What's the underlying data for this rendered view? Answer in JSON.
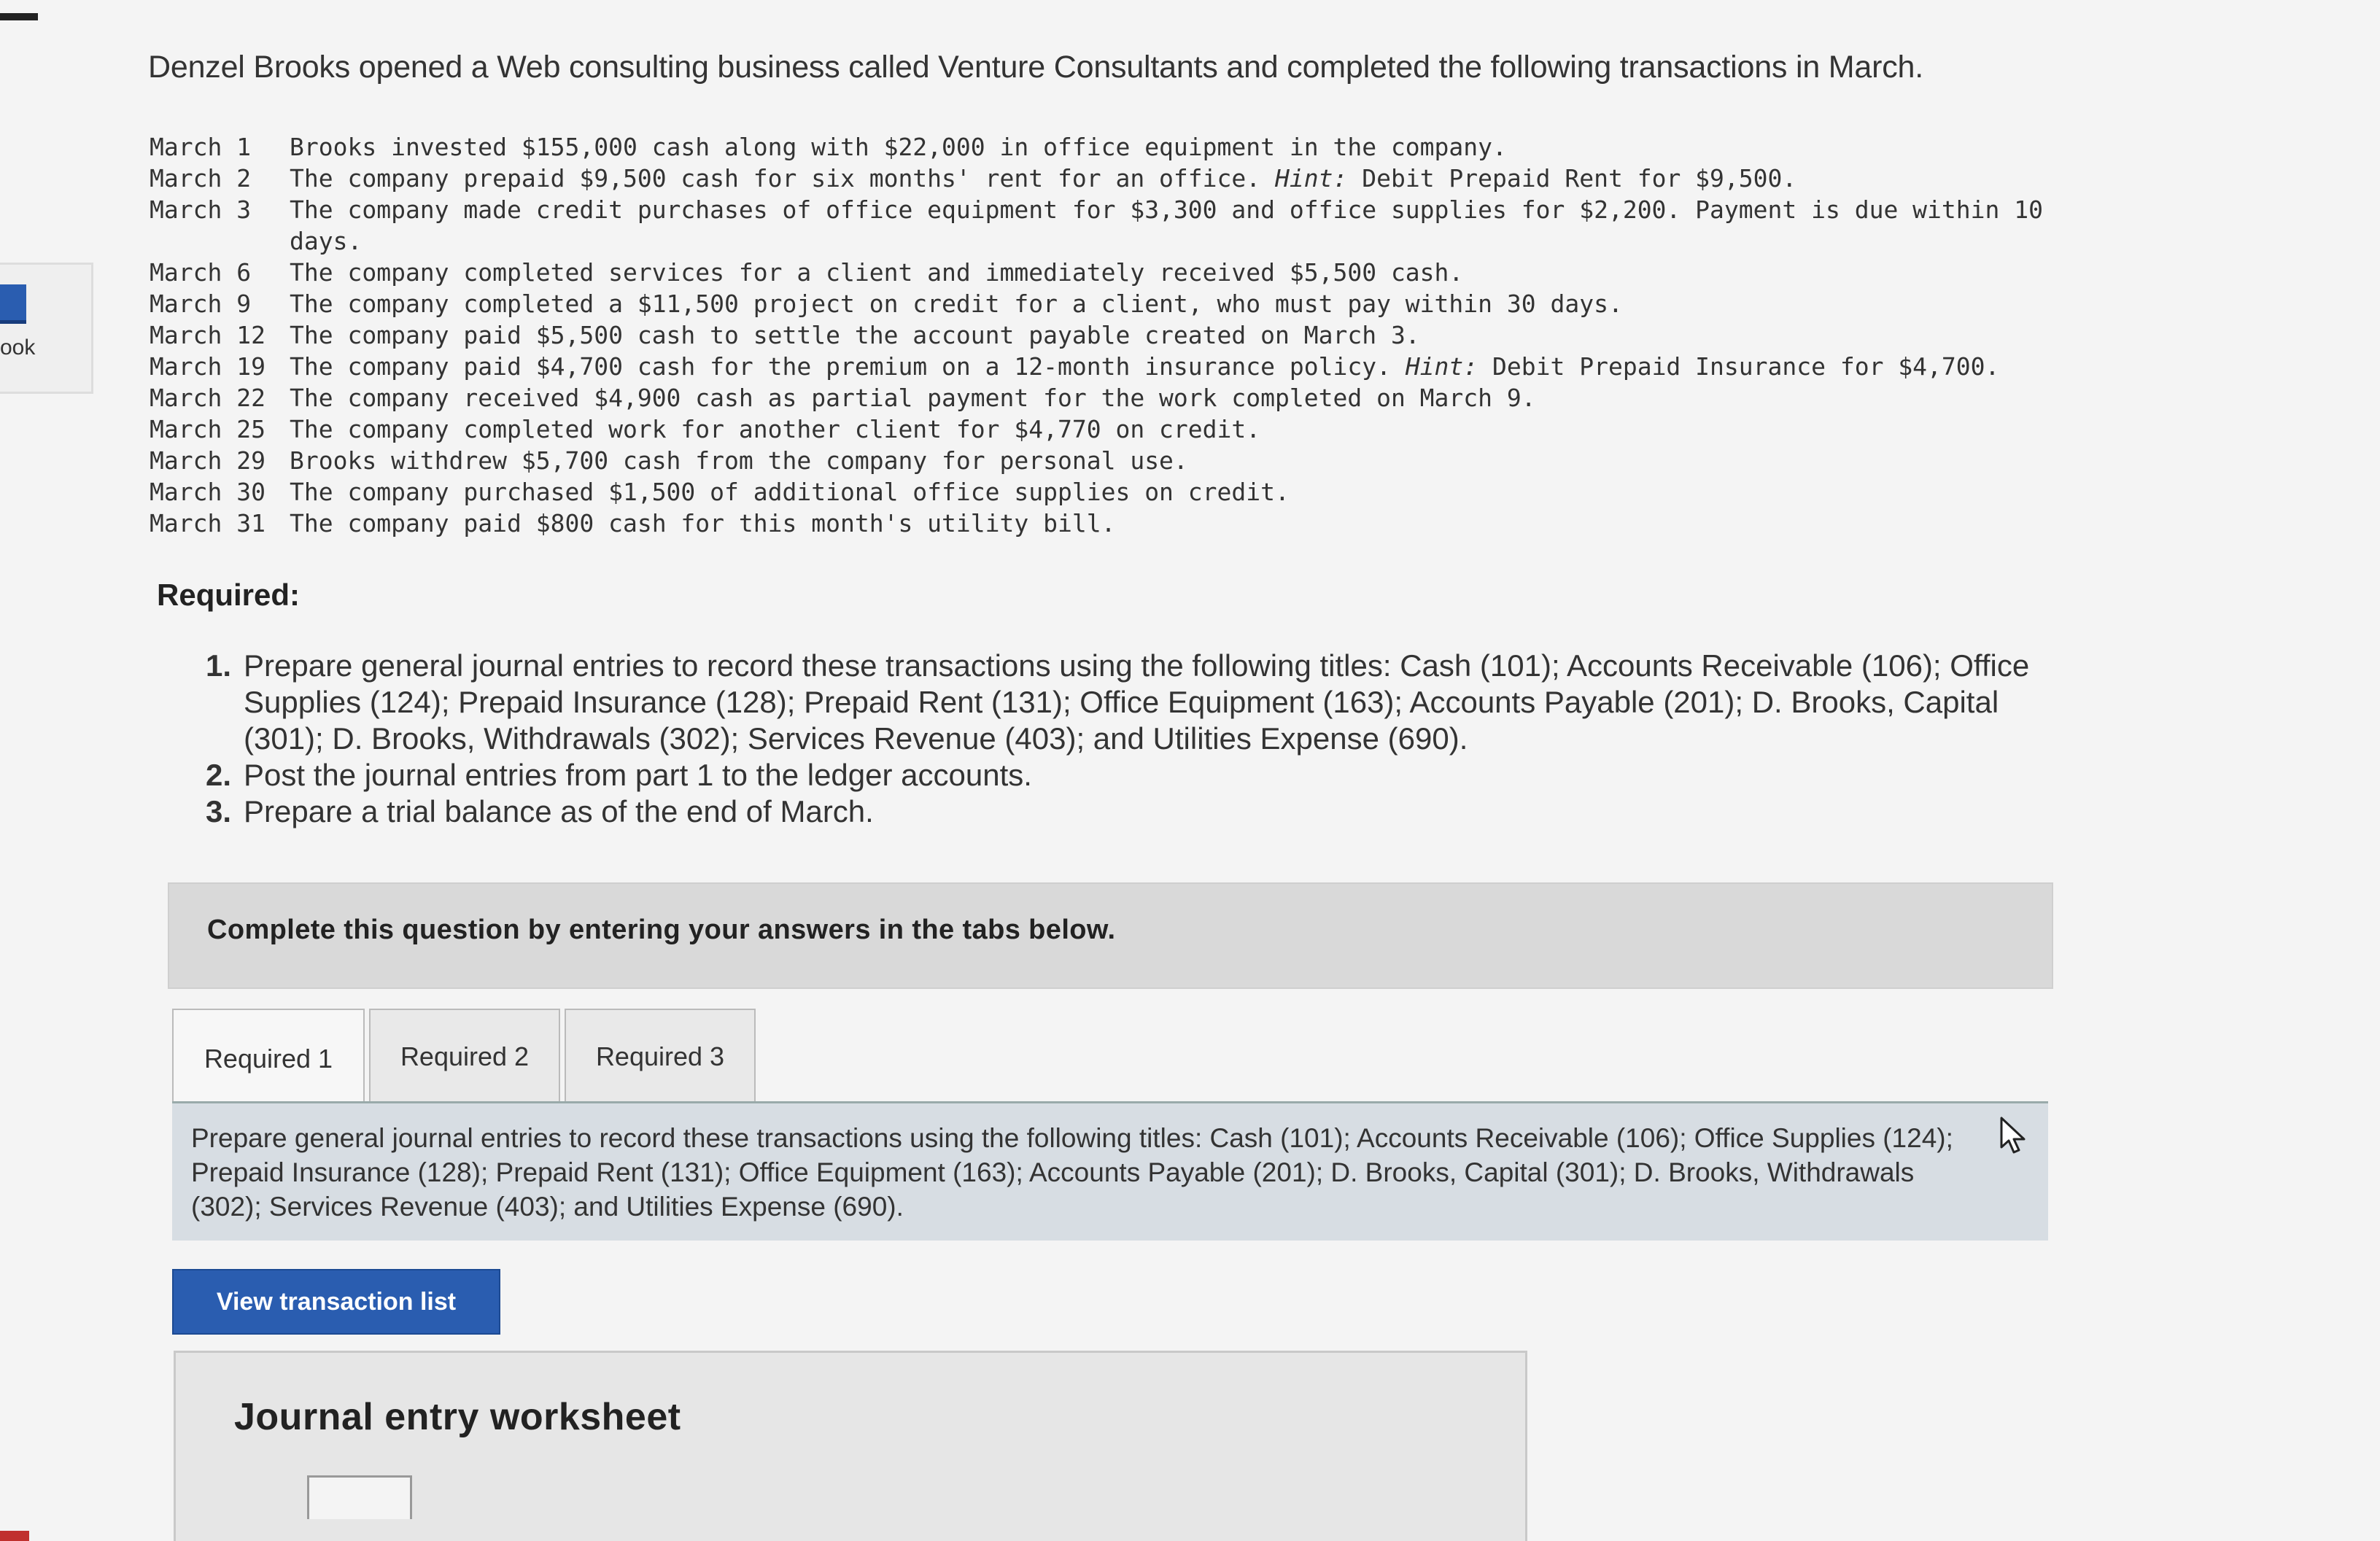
{
  "sidebar": {
    "book_label": "ook"
  },
  "intro": "Denzel Brooks opened a Web consulting business called Venture Consultants and completed the following transactions in March.",
  "transactions": [
    {
      "date": "March 1",
      "text": "Brooks invested $155,000 cash along with $22,000 in office equipment in the company."
    },
    {
      "date": "March 2",
      "text": "The company prepaid $9,500 cash for six months' rent for an office. ",
      "hint": "Hint:",
      "text_after": " Debit Prepaid Rent for $9,500."
    },
    {
      "date": "March 3",
      "text": "The company made credit purchases of office equipment for $3,300 and office supplies for $2,200. Payment is due within 10",
      "continuation": "days."
    },
    {
      "date": "March 6",
      "text": "The company completed services for a client and immediately received $5,500 cash."
    },
    {
      "date": "March 9",
      "text": "The company completed a $11,500 project on credit for a client, who must pay within 30 days."
    },
    {
      "date": "March 12",
      "text": "The company paid $5,500 cash to settle the account payable created on March 3."
    },
    {
      "date": "March 19",
      "text": "The company paid $4,700 cash for the premium on a 12-month insurance policy. ",
      "hint": "Hint:",
      "text_after": " Debit Prepaid Insurance for $4,700."
    },
    {
      "date": "March 22",
      "text": "The company received $4,900 cash as partial payment for the work completed on March 9."
    },
    {
      "date": "March 25",
      "text": "The company completed work for another client for $4,770 on credit."
    },
    {
      "date": "March 29",
      "text": "Brooks withdrew $5,700 cash from the company for personal use."
    },
    {
      "date": "March 30",
      "text": "The company purchased $1,500 of additional office supplies on credit."
    },
    {
      "date": "March 31",
      "text": "The company paid $800 cash for this month's utility bill."
    }
  ],
  "required": {
    "title": "Required:",
    "items": [
      {
        "num": "1.",
        "text": "Prepare general journal entries to record these transactions using the following titles: Cash (101); Accounts Receivable (106); Office Supplies (124); Prepaid Insurance (128); Prepaid Rent (131); Office Equipment (163); Accounts Payable (201); D. Brooks, Capital (301); D. Brooks, Withdrawals (302); Services Revenue (403); and Utilities Expense (690)."
      },
      {
        "num": "2.",
        "text": "Post the journal entries from part 1 to the ledger accounts."
      },
      {
        "num": "3.",
        "text": "Prepare a trial balance as of the end of March."
      }
    ]
  },
  "complete_instruction": "Complete this question by entering your answers in the tabs below.",
  "tabs": [
    "Required 1",
    "Required 2",
    "Required 3"
  ],
  "active_tab": "Required 1",
  "tab_instruction": "Prepare general journal entries to record these transactions using the following titles: Cash (101); Accounts Receivable (106); Office Supplies (124); Prepaid Insurance (128); Prepaid Rent (131); Office Equipment (163); Accounts Payable (201); D. Brooks, Capital (301); D. Brooks, Withdrawals (302); Services Revenue (403); and Utilities Expense (690).",
  "view_button": "View transaction list",
  "worksheet_title": "Journal entry worksheet",
  "icons": {
    "cursor": "mouse-pointer-icon",
    "sidebar": "book-icon"
  },
  "colors": {
    "button": "#2a5db0",
    "panel": "#d7dde3",
    "banner": "#d9d9d9"
  }
}
